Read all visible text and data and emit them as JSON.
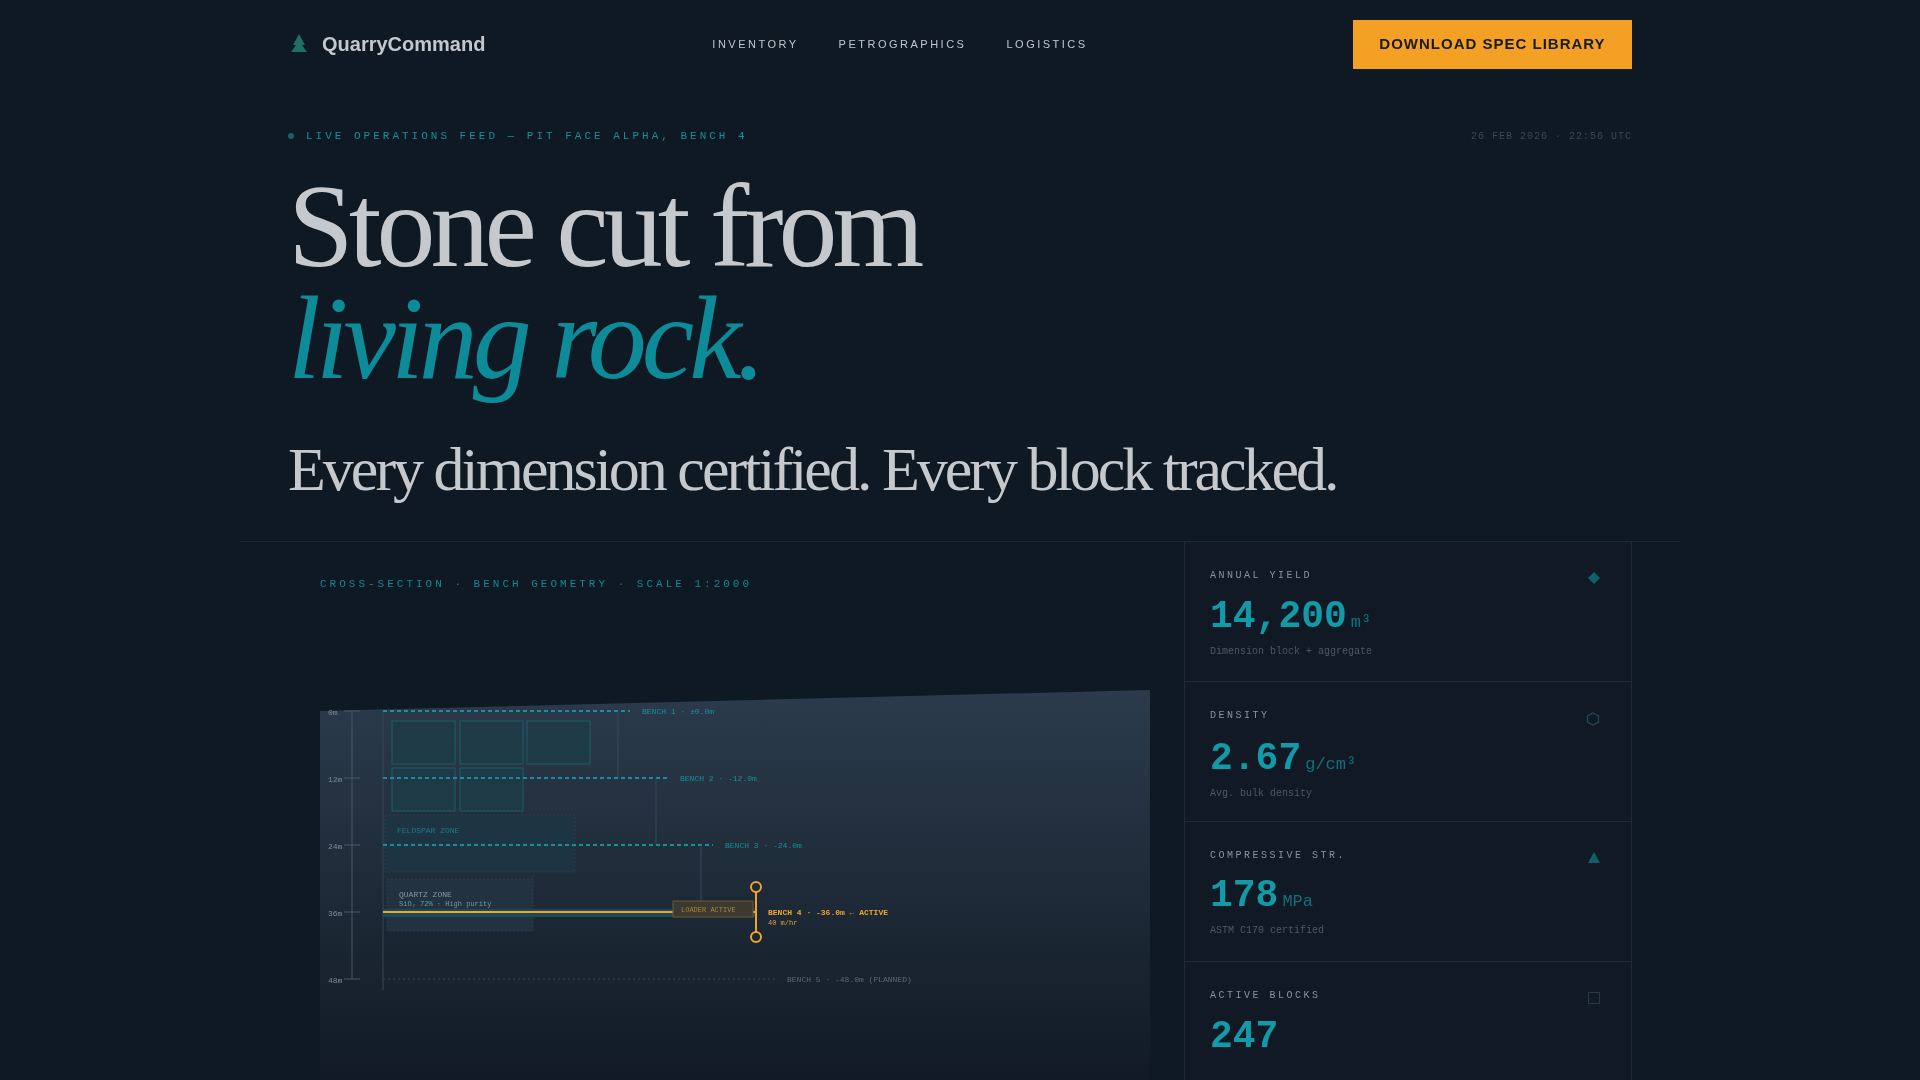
{
  "brand": {
    "name": "QuarryCommand"
  },
  "nav": [
    "INVENTORY",
    "PETROGRAPHICS",
    "LOGISTICS"
  ],
  "cta": "DOWNLOAD SPEC LIBRARY",
  "feed": {
    "label": "LIVE OPERATIONS FEED — PIT FACE ALPHA, BENCH 4",
    "timestamp": "26 FEB 2026 · 22:56 UTC"
  },
  "headline": {
    "line_1": "Stone cut from",
    "line_2": "living rock."
  },
  "subtitle": "Every dimension certified. Every block tracked.",
  "diagram": {
    "caption": "CROSS-SECTION · BENCH GEOMETRY · SCALE 1:2000",
    "depth_marks": [
      "0m",
      "12m",
      "24m",
      "36m",
      "48m"
    ],
    "benches": [
      {
        "kind": "complete",
        "label": "BENCH 1 · ±0.0m"
      },
      {
        "kind": "complete",
        "label": "BENCH 2 · -12.0m"
      },
      {
        "kind": "complete",
        "label": "BENCH 3 · -24.0m"
      },
      {
        "kind": "active",
        "label": "BENCH 4 · -36.0m ← ACTIVE",
        "rate": "40 m/hr",
        "equipment": "LOADER ACTIVE"
      },
      {
        "kind": "planned",
        "label": "BENCH 5 · -48.0m (PLANNED)"
      }
    ],
    "zones": [
      {
        "name": "FELDSPAR ZONE"
      },
      {
        "name": "QUARTZ ZONE",
        "detail": "SiO₂ 72% · High purity"
      }
    ]
  },
  "stats": [
    {
      "label": "ANNUAL YIELD",
      "value": "14,200",
      "unit": "m³",
      "note": "Dimension block + aggregate",
      "kind": "diamond"
    },
    {
      "label": "DENSITY",
      "value": "2.67",
      "unit": "g/cm³",
      "note": "Avg. bulk density",
      "kind": "hexagon"
    },
    {
      "label": "COMPRESSIVE STR.",
      "value": "178",
      "unit": "MPa",
      "note": "ASTM C170 certified",
      "kind": "triangle"
    },
    {
      "label": "ACTIVE BLOCKS",
      "value": "247",
      "kind": "square"
    }
  ]
}
